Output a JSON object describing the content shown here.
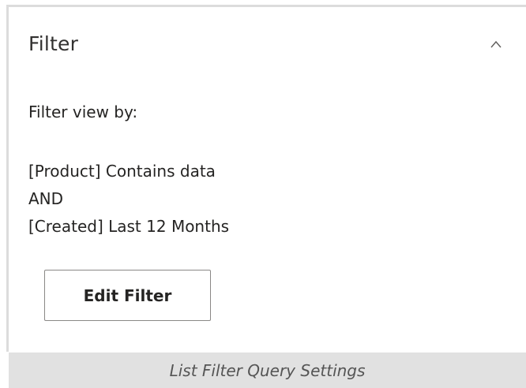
{
  "panel": {
    "title": "Filter",
    "collapse_icon": "chevron-up-icon",
    "filter_label": "Filter view by:",
    "query_lines": [
      "[Product] Contains data",
      "AND",
      "[Created] Last 12 Months"
    ],
    "edit_button_label": "Edit Filter"
  },
  "caption": "List Filter Query Settings",
  "colors": {
    "panel_border": "#dcdcdc",
    "caption_background": "#e1e1e1",
    "button_border": "#8a8886"
  }
}
